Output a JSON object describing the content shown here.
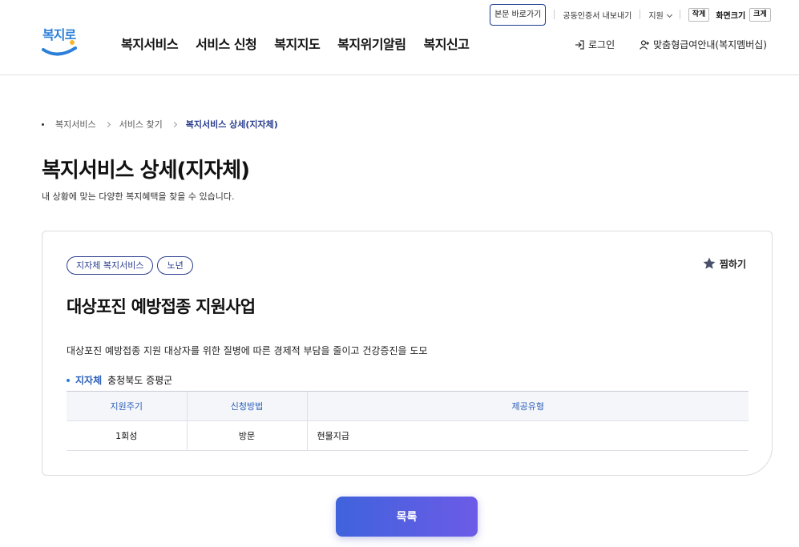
{
  "util": {
    "skip_link": "본문 바로가기",
    "cert_export": "공동인증서 내보내기",
    "support": "지원",
    "font_small": "작게",
    "zoom_label": "화면크기",
    "font_large": "크게"
  },
  "header": {
    "logo_text": "복지로",
    "nav": [
      "복지서비스",
      "서비스 신청",
      "복지지도",
      "복지위기알림",
      "복지신고"
    ],
    "login": "로그인",
    "membership": "맞춤형급여안내(복지멤버십)"
  },
  "breadcrumb": [
    "복지서비스",
    "서비스 찾기",
    "복지서비스 상세(지자체)"
  ],
  "page": {
    "title": "복지서비스 상세(지자체)",
    "subtitle": "내 상황에 맞는 다양한 복지혜택을 찾을 수 있습니다."
  },
  "card": {
    "tags": [
      "지자체 복지서비스",
      "노년"
    ],
    "favorite_label": "찜하기",
    "service_title": "대상포진 예방접종 지원사업",
    "description": "대상포진 예방접종 지원 대상자를 위한 질병에 따른 경제적 부담을 줄이고 건강증진을 도모",
    "region_label": "지자체",
    "region_value": "충청북도 증평군",
    "table": {
      "headers": [
        "지원주기",
        "신청방법",
        "제공유형"
      ],
      "row": [
        "1회성",
        "방문",
        "현물지급"
      ]
    }
  },
  "list_button": "목록",
  "colors": {
    "accent": "#2a3d8f",
    "button_start": "#3f63dc",
    "button_end": "#6c5be6"
  }
}
